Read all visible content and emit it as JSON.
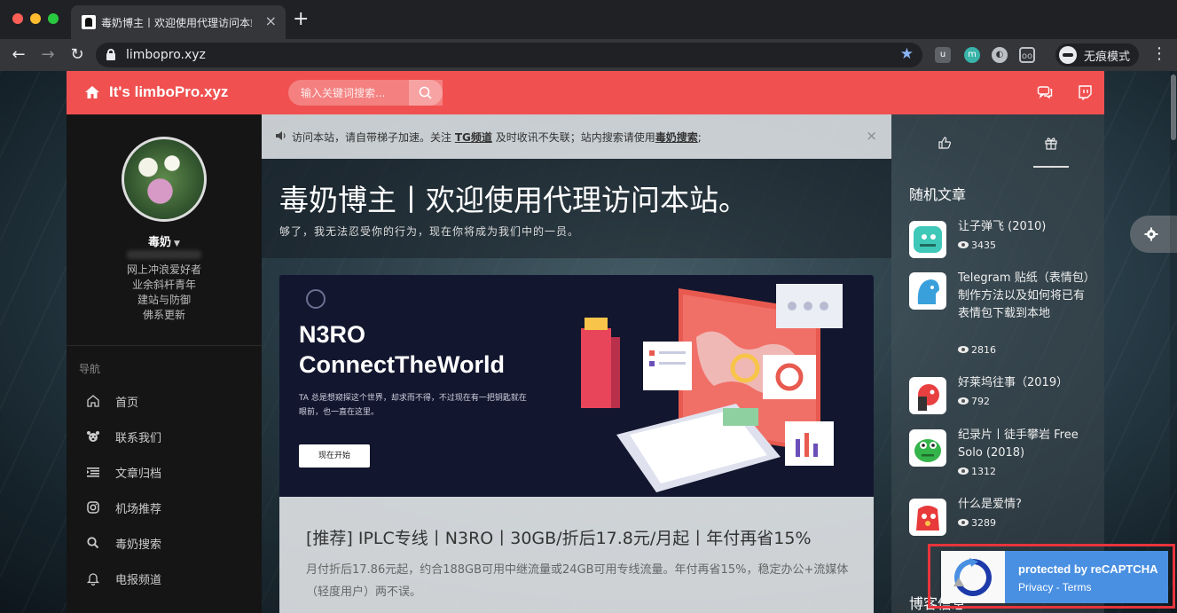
{
  "browser": {
    "tab_title": "毒奶博主丨欢迎使用代理访问本站",
    "tab_close": "×",
    "new_tab": "+",
    "url": "limbopro.xyz",
    "incognito_label": "无痕模式"
  },
  "header": {
    "brand": "It's limboPro.xyz",
    "search_placeholder": "输入关键词搜索..."
  },
  "profile": {
    "name": "毒奶",
    "bio": [
      "网上冲浪爱好者",
      "业余斜杆青年",
      "建站与防御",
      "佛系更新"
    ]
  },
  "nav": {
    "label": "导航",
    "items": [
      {
        "label": "首页",
        "icon": "home-icon"
      },
      {
        "label": "联系我们",
        "icon": "bear-icon"
      },
      {
        "label": "文章归档",
        "icon": "list-icon"
      },
      {
        "label": "机场推荐",
        "icon": "instagram-icon"
      },
      {
        "label": "毒奶搜索",
        "icon": "search-icon"
      },
      {
        "label": "电报频道",
        "icon": "bell-icon"
      }
    ]
  },
  "notice": {
    "part1": "访问本站，请自带梯子加速。关注",
    "link1": "TG频道",
    "part2": "及时收讯不失联；站内搜索请使用",
    "link2": "毒奶搜索",
    "part3": ";",
    "close": "×"
  },
  "hero": {
    "title": "毒奶博主丨欢迎使用代理访问本站。",
    "subtitle": "够了，我无法忍受你的行为，现在你将成为我们中的一员。"
  },
  "banner": {
    "line1": "N3RO",
    "line2": "ConnectTheWorld",
    "desc": "TA 总是想窥探这个世界，却求而不得，不过现在有一把钥匙就在眼前，也一直在这里。",
    "button": "现在开始"
  },
  "post": {
    "title": "[推荐] IPLC专线丨N3RO丨30GB/折后17.8元/月起丨年付再省15%",
    "excerpt": "月付折后17.86元起，约合188GB可用中继流量或24GB可用专线流量。年付再省15%，稳定办公+流媒体（轻度用户）两不误。"
  },
  "sidebar_right": {
    "section_title": "随机文章",
    "articles": [
      {
        "title": "让子弹飞 (2010)",
        "views": "3435"
      },
      {
        "title": "Telegram 贴纸（表情包）制作方法以及如何将已有表情包下载到本地",
        "views": "2816"
      },
      {
        "title": "好莱坞往事（2019）",
        "views": "792"
      },
      {
        "title": "纪录片丨徒手攀岩 Free Solo (2018)",
        "views": "1312"
      },
      {
        "title": "什么是爱情?",
        "views": "3289"
      }
    ],
    "blog_info_title": "博客信息"
  },
  "recaptcha": {
    "line1": "protected by reCAPTCHA",
    "line2": "Privacy - Terms"
  },
  "colors": {
    "header_red": "#f05050",
    "recaptcha_blue": "#4a90e2",
    "highlight_red": "#e8343c"
  }
}
